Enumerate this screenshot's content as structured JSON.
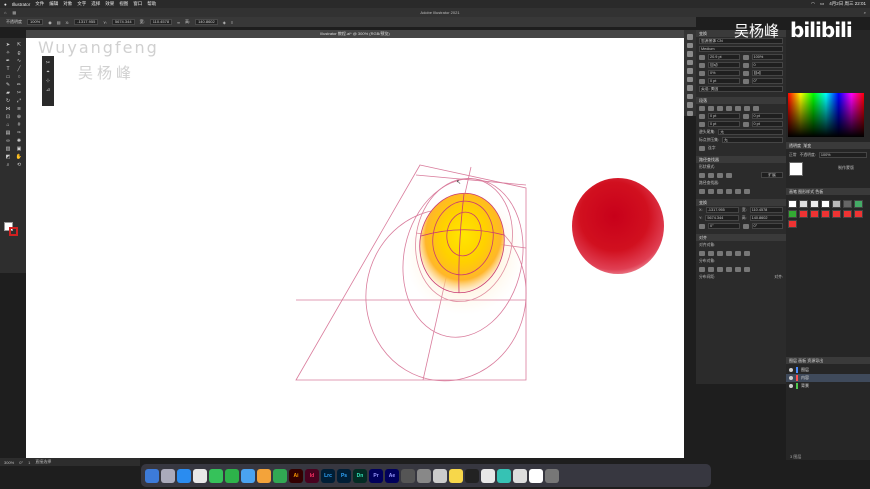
{
  "menubar": {
    "items": [
      "Illustrator",
      "文件",
      "编辑",
      "对象",
      "文字",
      "选择",
      "效果",
      "视图",
      "窗口",
      "帮助"
    ],
    "app_center_title": "Adobe Illustrator 2021",
    "clock": "4月2日 周三 22:01"
  },
  "control_bar": {
    "mode": "不透明度",
    "opacity": "100%",
    "x_label": "X:",
    "x_value": "-1317.955",
    "y_label": "Y:",
    "y_value": "5674.344",
    "w_label": "宽:",
    "w_value": "110.4578",
    "h_label": "高:",
    "h_value": "140.8602"
  },
  "doc_tab": {
    "title": "Illustrator 教程.ai* @ 300% (RGB/预览)"
  },
  "watermark": {
    "line1": "Wuyangfeng",
    "line2": "吴杨峰",
    "brand_cn": "吴杨峰",
    "brand_logo": "bilibili"
  },
  "properties_panel": {
    "tab_transform": "变换",
    "font_family": "思源黑体 CN",
    "font_style": "Medium",
    "font_size": "20.9 pt",
    "leading": "100%",
    "tracking": "自动",
    "scale": "0",
    "percent": "0%",
    "kerning": "自动",
    "pt0": "0 pt",
    "deg0": "0°",
    "lang": "英语: 美国",
    "paragraph_title": "段落",
    "indent_left": "0 pt",
    "indent_right": "0 pt",
    "space_before": "0 pt",
    "space_after": "0 pt",
    "hyphenation_label": "避头尾集:",
    "hyphenation_value": "无",
    "punct_label": "标点挤压集:",
    "punct_value": "无",
    "hyphen_check": "连字",
    "path_title": "路径查找器",
    "shape_modes": "形状模式:",
    "expand": "扩展",
    "path_finder": "路径查找器:",
    "transform_title": "变换",
    "t_x": "-1317.955",
    "t_y": "5674.344",
    "t_w": "110.4578",
    "t_h": "140.8602",
    "t_angle": "0°",
    "t_shear": "0°",
    "align_title": "对齐",
    "align_objects": "对齐对象:",
    "distribute_objects": "分布对象:",
    "distribute_spacing": "分布间距:",
    "align_to": "对齐:"
  },
  "right_panel": {
    "tab_color": "颜色",
    "tab_guide": "颜色参考",
    "tab_swatch": "色板",
    "hex_label": "#",
    "transparency_tab": "透明度",
    "gradient_tab": "渐变",
    "opacity_label": "不透明度:",
    "opacity_value": "100%",
    "mode_label": "正常",
    "make_mask": "制作蒙版",
    "clip": "剪切",
    "invert_mask": "反相蒙版",
    "brush_tab": "画笔",
    "symbol_tab": "图形样式",
    "swatch_tab": "色板",
    "layers_tab": "图层",
    "artboard_tab": "画板",
    "assets_tab": "资源导出",
    "layers": [
      {
        "name": "图层",
        "color": "#4a8cff"
      },
      {
        "name": "内容",
        "color": "#ff5050"
      },
      {
        "name": "背景",
        "color": "#50c850"
      }
    ],
    "layer_count": "3 图层"
  },
  "status_bar": {
    "zoom": "300%",
    "angle": "0°",
    "page": "1",
    "tool": "直接选择"
  },
  "dock": {
    "apps": [
      "Finder",
      "Launchpad",
      "Safari",
      "Chrome",
      "Messages",
      "WeChat",
      "FaceTime",
      "Photos",
      "Ai",
      "Id",
      "Lrc",
      "Ps",
      "Dn",
      "Pr",
      "Ae",
      "QuickTime",
      "System",
      "Preview",
      "Notes",
      "Terminal",
      "Trash"
    ]
  }
}
